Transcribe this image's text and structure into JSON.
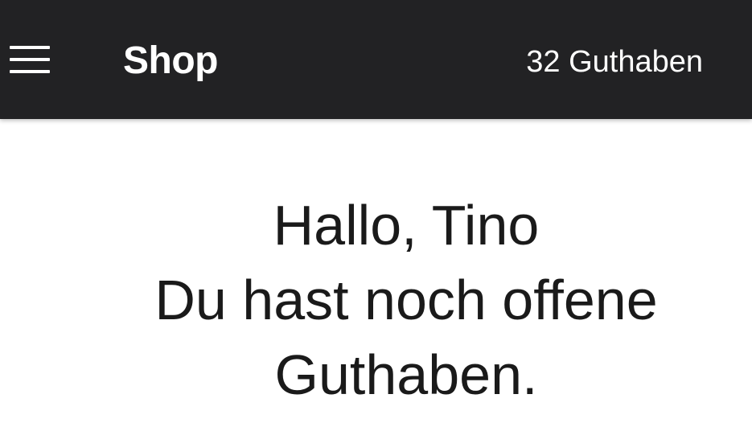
{
  "appbar": {
    "menu_icon": "hamburger-menu-icon",
    "title": "Shop",
    "credits": "32 Guthaben",
    "background_color": "#222224"
  },
  "main": {
    "greeting_line1": "Hallo, Tino",
    "greeting_line2": "Du hast noch offene",
    "greeting_line3": "Guthaben."
  }
}
